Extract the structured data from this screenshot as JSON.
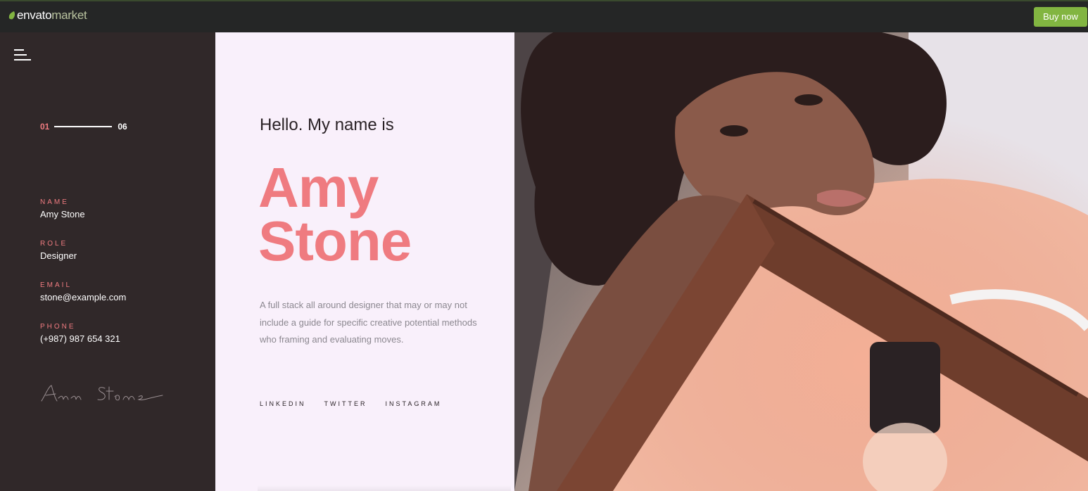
{
  "topbar": {
    "logo_main": "envato",
    "logo_sub": "market",
    "buy_label": "Buy now"
  },
  "pager": {
    "current": "01",
    "total": "06",
    "progress": 0.17
  },
  "profile": [
    {
      "label": "NAME",
      "value": "Amy Stone"
    },
    {
      "label": "ROLE",
      "value": "Designer"
    },
    {
      "label": "EMAIL",
      "value": "stone@example.com"
    },
    {
      "label": "PHONE",
      "value": "(+987) 987 654 321"
    }
  ],
  "hero": {
    "greeting": "Hello. My name is",
    "first_name": "Amy",
    "last_name": "Stone",
    "description": "A full stack all around designer that may or may not include a guide for specific creative potential methods who framing and evaluating moves."
  },
  "socials": [
    "LINKEDIN",
    "TWITTER",
    "INSTAGRAM"
  ],
  "colors": {
    "accent": "#ef7b80",
    "sidebar_bg": "#302829",
    "content_bg": "#f9f0fb",
    "buy_button": "#82b541"
  }
}
